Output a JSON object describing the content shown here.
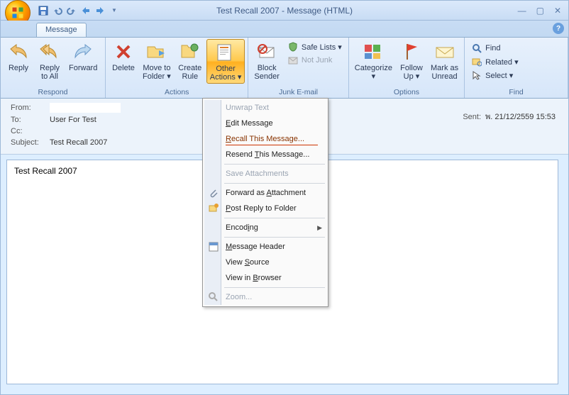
{
  "window": {
    "title": "Test Recall 2007 - Message (HTML)"
  },
  "tabs": {
    "message": "Message"
  },
  "ribbon": {
    "respond": {
      "label": "Respond",
      "reply": "Reply",
      "reply_all": "Reply\nto All",
      "forward": "Forward"
    },
    "actions": {
      "label": "Actions",
      "delete": "Delete",
      "move_to_folder": "Move to\nFolder ▾",
      "create_rule": "Create\nRule",
      "other_actions": "Other\nActions ▾"
    },
    "junk": {
      "label": "Junk E-mail",
      "block_sender": "Block\nSender",
      "safe_lists": "Safe Lists ▾",
      "not_junk": "Not Junk"
    },
    "options": {
      "label": "Options",
      "categorize": "Categorize\n▾",
      "follow_up": "Follow\nUp ▾",
      "mark_unread": "Mark as\nUnread"
    },
    "find": {
      "label": "Find",
      "find": "Find",
      "related": "Related ▾",
      "select": "Select ▾"
    }
  },
  "header": {
    "from_label": "From:",
    "from_value": "",
    "to_label": "To:",
    "to_value": "User For Test",
    "cc_label": "Cc:",
    "cc_value": "",
    "subject_label": "Subject:",
    "subject_value": "Test Recall 2007",
    "sent_label": "Sent:",
    "sent_value": "พ. 21/12/2559 15:53"
  },
  "body": {
    "text": "Test Recall 2007"
  },
  "dropdown": {
    "items": [
      {
        "label": "Unwrap Text",
        "disabled": true
      },
      {
        "label": "Edit Message",
        "u": 0
      },
      {
        "label": "Recall This Message...",
        "u": 0,
        "highlighted": true,
        "underline_row": true
      },
      {
        "label": "Resend This Message...",
        "u": 7
      },
      {
        "sep": true
      },
      {
        "label": "Save Attachments",
        "disabled": true
      },
      {
        "sep": true
      },
      {
        "label": "Forward as Attachment",
        "icon": "attach",
        "u": 11
      },
      {
        "label": "Post Reply to Folder",
        "icon": "post",
        "u": 0
      },
      {
        "sep": true
      },
      {
        "label": "Encoding",
        "submenu": true,
        "u": 5
      },
      {
        "sep": true
      },
      {
        "label": "Message Header",
        "icon": "header",
        "u": 0
      },
      {
        "label": "View Source",
        "u": 5
      },
      {
        "label": "View in Browser",
        "u": 8
      },
      {
        "sep": true
      },
      {
        "label": "Zoom...",
        "disabled": true,
        "icon": "zoom",
        "u": 0
      }
    ]
  }
}
